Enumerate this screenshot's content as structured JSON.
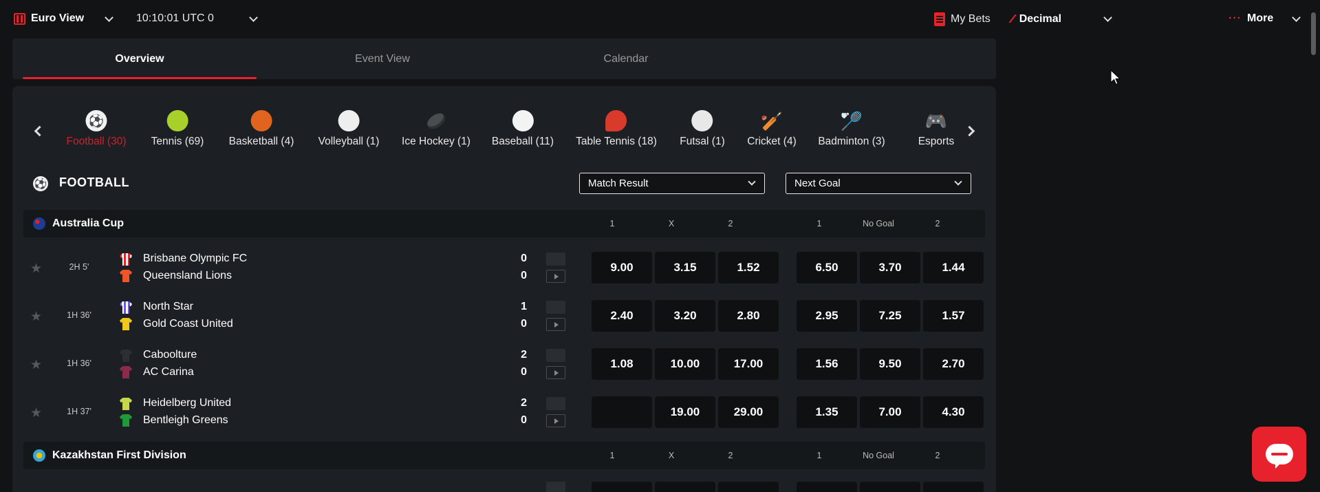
{
  "topbar": {
    "view_label": "Euro View",
    "time_label": "10:10:01 UTC 0",
    "my_bets_label": "My Bets",
    "odds_format_label": "Decimal",
    "more_label": "More"
  },
  "tabs": [
    {
      "label": "Overview",
      "active": true
    },
    {
      "label": "Event View",
      "active": false
    },
    {
      "label": "Calendar",
      "active": false
    }
  ],
  "sports": [
    {
      "label": "Football (30)",
      "icon": "football-icon",
      "active": true
    },
    {
      "label": "Tennis (69)",
      "icon": "tennis-icon"
    },
    {
      "label": "Basketball (4)",
      "icon": "basketball-icon"
    },
    {
      "label": "Volleyball (1)",
      "icon": "volleyball-icon"
    },
    {
      "label": "Ice Hockey (1)",
      "icon": "ice-hockey-icon"
    },
    {
      "label": "Baseball (11)",
      "icon": "baseball-icon"
    },
    {
      "label": "Table Tennis (18)",
      "icon": "table-tennis-icon"
    },
    {
      "label": "Futsal (1)",
      "icon": "futsal-icon"
    },
    {
      "label": "Cricket (4)",
      "icon": "cricket-icon"
    },
    {
      "label": "Badminton (3)",
      "icon": "badminton-icon"
    },
    {
      "label": "Esports",
      "icon": "esports-icon"
    }
  ],
  "section": {
    "title": "FOOTBALL",
    "market1": "Match Result",
    "market2": "Next Goal"
  },
  "market_headers": [
    "1",
    "X",
    "2",
    "1",
    "No Goal",
    "2"
  ],
  "leagues": [
    {
      "name": "Australia Cup",
      "matches": [
        {
          "time": "2H  5'",
          "home": "Brisbane Olympic FC",
          "away": "Queensland Lions",
          "home_score": "0",
          "away_score": "0",
          "odds": [
            "9.00",
            "3.15",
            "1.52",
            "6.50",
            "3.70",
            "1.44"
          ]
        },
        {
          "time": "1H  36'",
          "home": "North Star",
          "away": "Gold Coast United",
          "home_score": "1",
          "away_score": "0",
          "odds": [
            "2.40",
            "3.20",
            "2.80",
            "2.95",
            "7.25",
            "1.57"
          ]
        },
        {
          "time": "1H  36'",
          "home": "Caboolture",
          "away": "AC Carina",
          "home_score": "2",
          "away_score": "0",
          "odds": [
            "1.08",
            "10.00",
            "17.00",
            "1.56",
            "9.50",
            "2.70"
          ]
        },
        {
          "time": "1H  37'",
          "home": "Heidelberg United",
          "away": "Bentleigh Greens",
          "home_score": "2",
          "away_score": "0",
          "odds": [
            "",
            "19.00",
            "29.00",
            "1.35",
            "7.00",
            "4.30"
          ]
        }
      ]
    },
    {
      "name": "Kazakhstan First Division",
      "matches": []
    }
  ],
  "colors": {
    "accent": "#e8222c",
    "panel": "#1c1f23",
    "odds_button": "#0e1012"
  }
}
